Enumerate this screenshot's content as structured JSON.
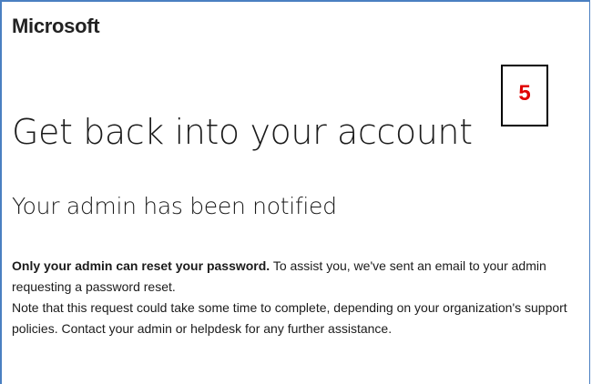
{
  "brand": {
    "name": "Microsoft"
  },
  "step_badge": {
    "number": "5",
    "color": "#e00000"
  },
  "page": {
    "title": "Get back into your account",
    "subtitle": "Your admin has been notified"
  },
  "message": {
    "bold_lead": "Only your admin can reset your password.",
    "lead_rest": " To assist you, we've sent an email to your admin requesting a password reset.",
    "note": "Note that this request could take some time to complete, depending on your organization's support policies. Contact your admin or helpdesk for any further assistance."
  },
  "colors": {
    "frame_border": "#4a7fc1",
    "text": "#1b1b1b"
  }
}
